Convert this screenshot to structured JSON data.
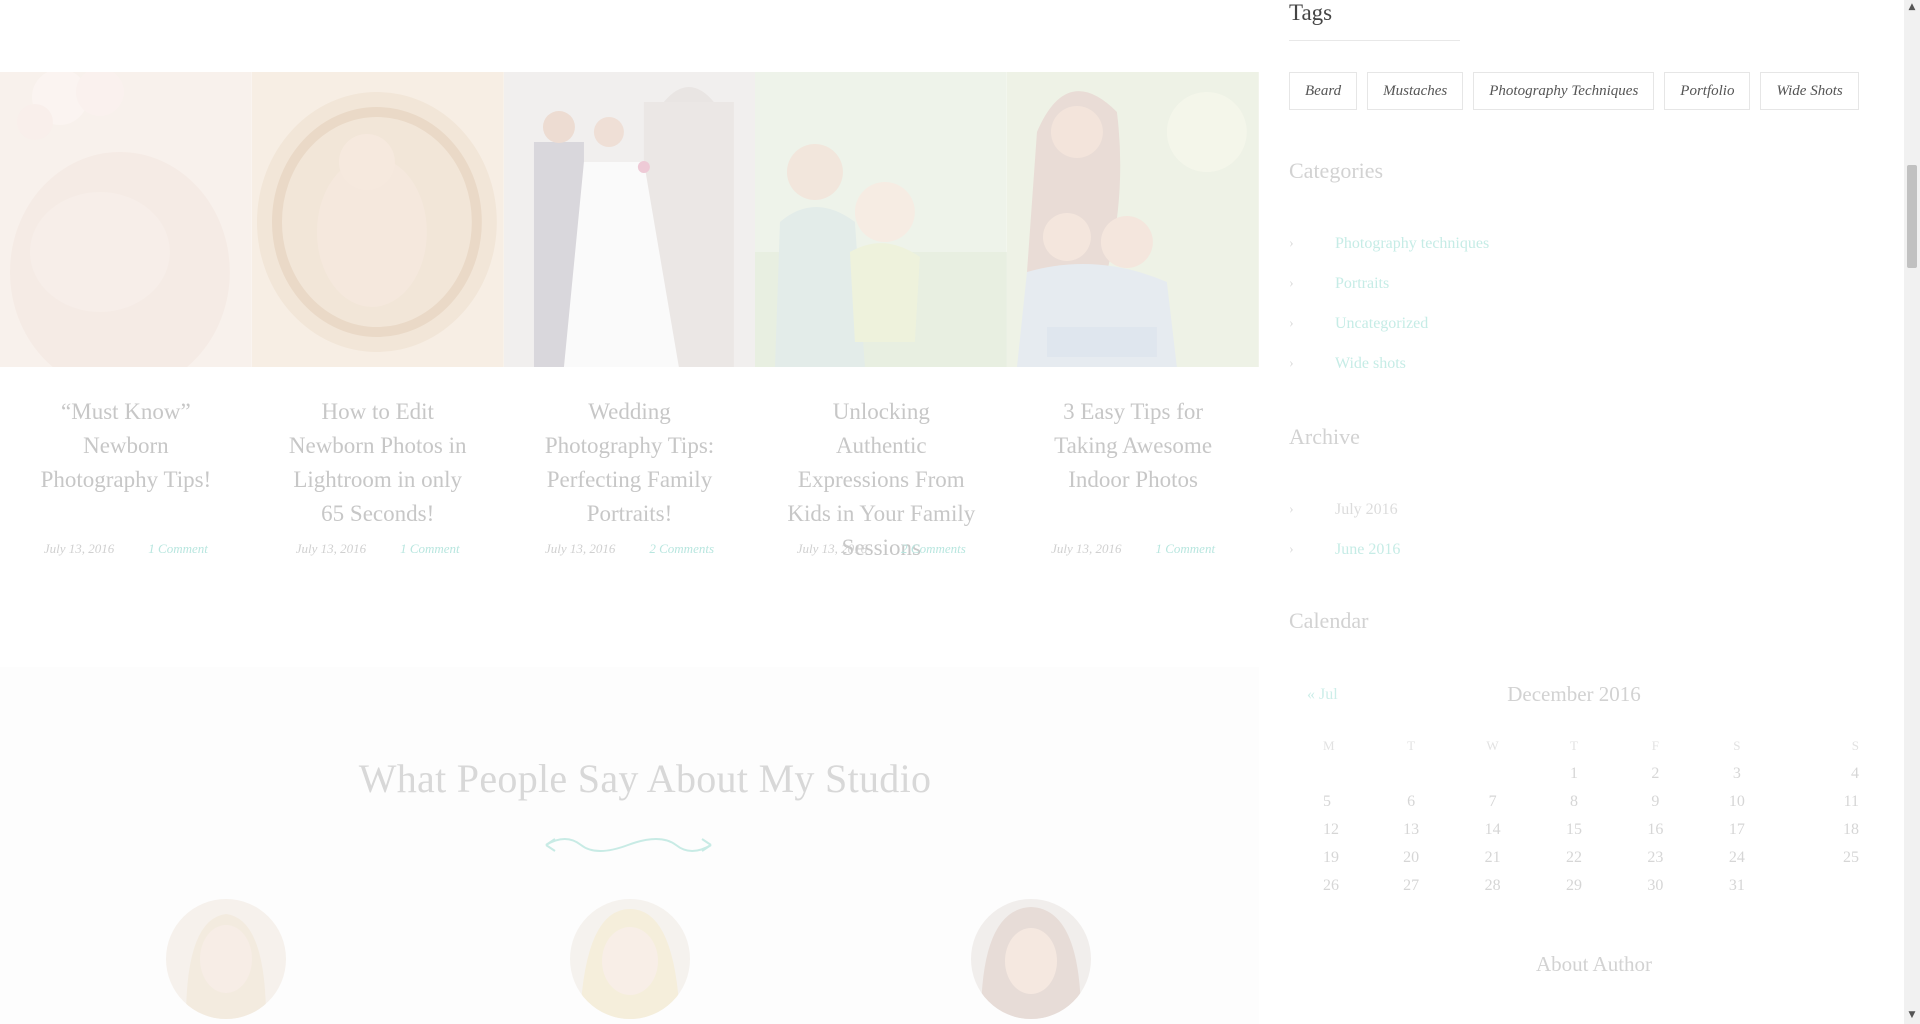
{
  "posts": [
    {
      "title": "“Must Know” Newborn Photography Tips!",
      "date": "July 13, 2016",
      "comments": "1 Comment",
      "image": "newborn-flowers-photo"
    },
    {
      "title": "How to Edit Newborn Photos in Lightroom in only 65 Seconds!",
      "date": "July 13, 2016",
      "comments": "1 Comment",
      "image": "newborn-basket-photo"
    },
    {
      "title": "Wedding Photography Tips: Perfecting Family Portraits!",
      "date": "July 13, 2016",
      "comments": "2 Comments",
      "image": "wedding-couple-photo"
    },
    {
      "title": "Unlocking Authentic Expressions From Kids in Your Family Sessions",
      "date": "July 13, 2016",
      "comments": "2 Comments",
      "image": "mother-child-photo"
    },
    {
      "title": "3 Easy Tips for Taking Awesome Indoor Photos",
      "date": "July 13, 2016",
      "comments": "1 Comment",
      "image": "mother-daughters-photo"
    }
  ],
  "testimonials": {
    "heading": "What People Say About My Studio",
    "avatars": [
      "client-avatar-1",
      "client-avatar-2",
      "client-avatar-3"
    ]
  },
  "sidebar": {
    "tags_title": "Tags",
    "tags": [
      "Beard",
      "Mustaches",
      "Photography Techniques",
      "Portfolio",
      "Wide Shots"
    ],
    "categories_title": "Categories",
    "categories": [
      "Photography techniques",
      "Portraits",
      "Uncategorized",
      "Wide shots"
    ],
    "archive_title": "Archive",
    "archive": [
      "July 2016",
      "June 2016"
    ],
    "calendar_title": "Calendar",
    "calendar": {
      "prev": "« Jul",
      "month": "December 2016",
      "days": [
        "M",
        "T",
        "W",
        "T",
        "F",
        "S",
        "S"
      ],
      "weeks": [
        [
          "",
          "",
          "",
          "1",
          "2",
          "3",
          "4"
        ],
        [
          "5",
          "6",
          "7",
          "8",
          "9",
          "10",
          "11"
        ],
        [
          "12",
          "13",
          "14",
          "15",
          "16",
          "17",
          "18"
        ],
        [
          "19",
          "20",
          "21",
          "22",
          "23",
          "24",
          "25"
        ],
        [
          "26",
          "27",
          "28",
          "29",
          "30",
          "31",
          ""
        ]
      ]
    },
    "about_title": "About Author"
  },
  "colors": {
    "accent": "#b8e6df",
    "muted_text": "#c7c7c7"
  }
}
